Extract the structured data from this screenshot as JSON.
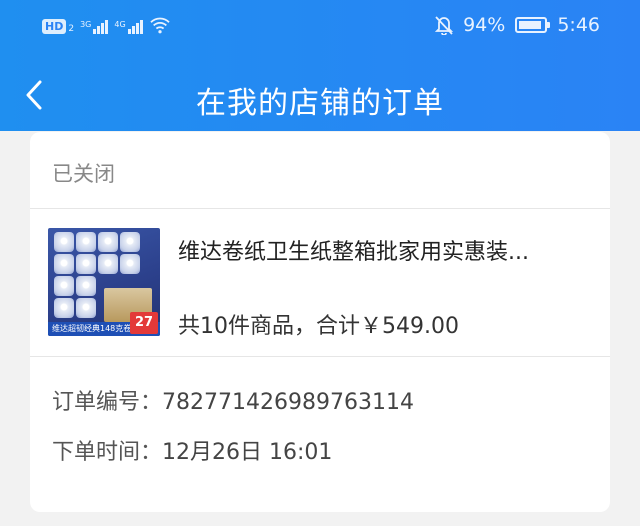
{
  "status_bar": {
    "hd": "HD",
    "hd_sub": "2",
    "net1_label": "3G",
    "net2_label": "4G",
    "battery_pct": "94%",
    "time": "5:46",
    "icons": [
      "hd-icon",
      "signal-icon",
      "wifi-icon",
      "mute-bell-icon",
      "battery-icon"
    ]
  },
  "nav": {
    "back_icon": "chevron-left-icon",
    "title": "在我的店铺的订单"
  },
  "order": {
    "status": "已关闭",
    "product": {
      "name": "维达卷纸卫生纸整箱批家用实惠装...",
      "summary": "共10件商品，合计￥549.00",
      "thumb_banner": "维达超韧经典148克卷纸",
      "thumb_price": "27"
    },
    "number_label": "订单编号：",
    "number_value": "782771426989763114",
    "time_label": "下单时间：",
    "time_value": "12月26日 16:01"
  },
  "colors": {
    "header_blue": "#2a83f5",
    "background": "#f2f2f2"
  }
}
